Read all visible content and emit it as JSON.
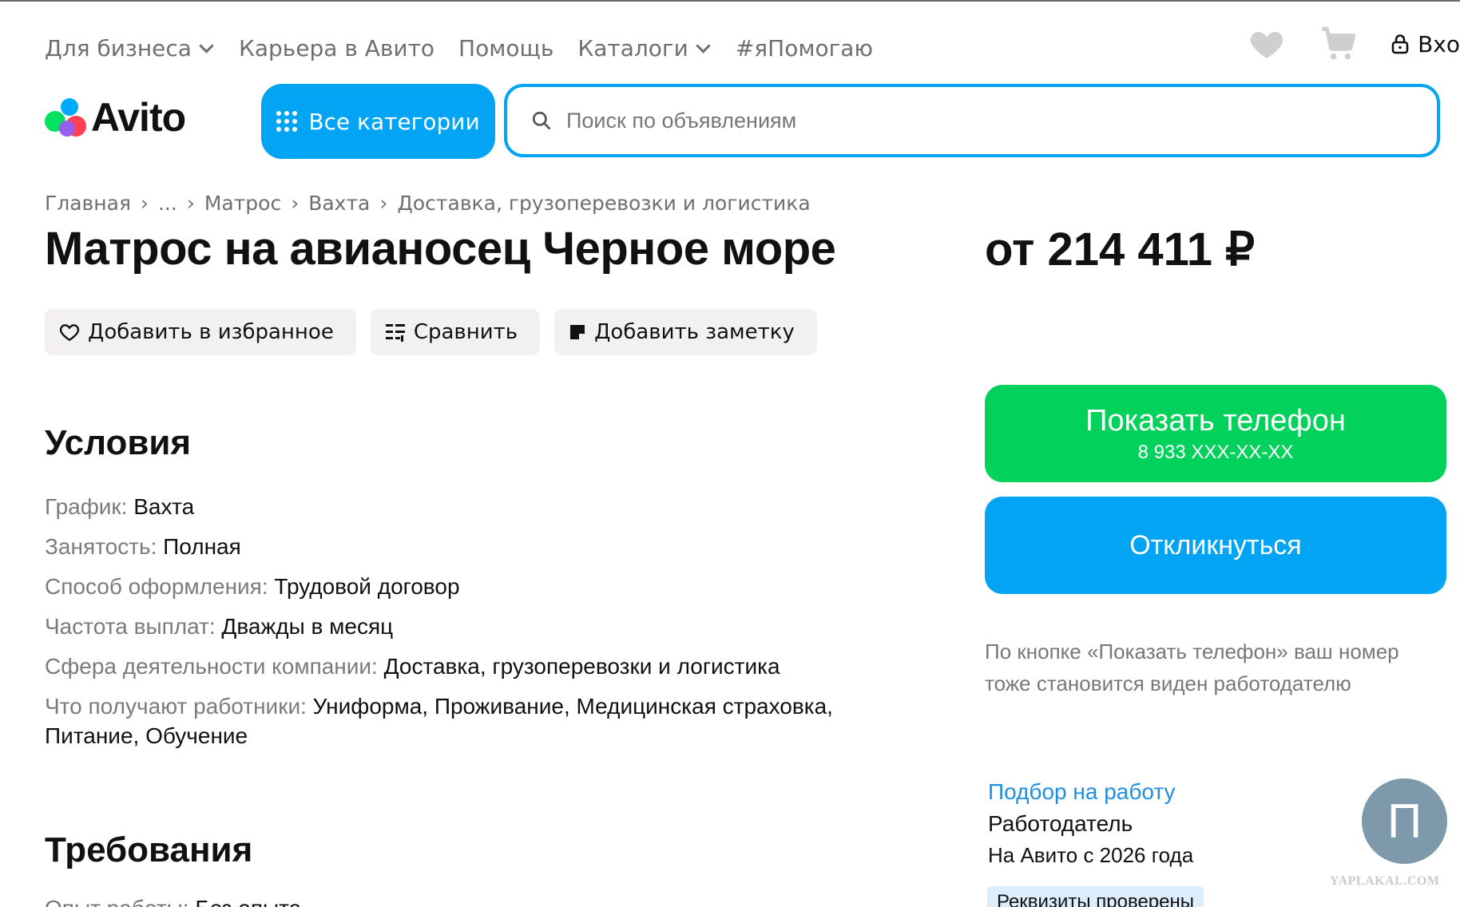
{
  "topnav": [
    {
      "label": "Для бизнеса",
      "dropdown": true
    },
    {
      "label": "Карьера в Авито",
      "dropdown": false
    },
    {
      "label": "Помощь",
      "dropdown": false
    },
    {
      "label": "Каталоги",
      "dropdown": true
    },
    {
      "label": "#яПомогаю",
      "dropdown": false
    }
  ],
  "header": {
    "login_label": "Вхо",
    "icons": [
      "favorites-heart-icon",
      "cart-icon",
      "lock-icon"
    ]
  },
  "logo": {
    "text": "Avito",
    "colors": {
      "green": "#04e061",
      "blue": "#00aaff",
      "red": "#ff4053",
      "purple": "#965eeb"
    }
  },
  "all_categories": {
    "label": "Все категории"
  },
  "search": {
    "placeholder": "Поиск по объявлениям"
  },
  "breadcrumb": [
    "Главная",
    "...",
    "Матрос",
    "Вахта",
    "Доставка, грузоперевозки и логистика"
  ],
  "listing": {
    "title": "Матрос на авианосец Черное море",
    "price": "от 214 411 ₽"
  },
  "actions": {
    "favorite": "Добавить в избранное",
    "compare": "Сравнить",
    "note": "Добавить заметку"
  },
  "conditions": {
    "heading": "Условия",
    "rows": [
      {
        "key": "График:",
        "value": "Вахта"
      },
      {
        "key": "Занятость:",
        "value": "Полная"
      },
      {
        "key": "Способ оформления:",
        "value": "Трудовой договор"
      },
      {
        "key": "Частота выплат:",
        "value": "Дважды в месяц"
      },
      {
        "key": "Сфера деятельности компании:",
        "value": "Доставка, грузоперевозки и логистика"
      },
      {
        "key": "Что получают работники:",
        "value": "Униформа, Проживание, Медицинская страховка, Питание, Обучение"
      }
    ]
  },
  "requirements": {
    "heading": "Требования",
    "partial_key": "Опыт работы:",
    "partial_value": "Без опыта"
  },
  "contact": {
    "phone_label": "Показать телефон",
    "phone_masked": "8 933 XXX-XX-XX",
    "respond_label": "Откликнуться",
    "note": "По кнопке «Показать телефон» ваш номер тоже становится виден работодателю",
    "colors": {
      "green": "#02d15c",
      "blue": "#04a4f4"
    }
  },
  "employer": {
    "link": "Подбор на работу",
    "role": "Работодатель",
    "since": "На Авито с 2026 года",
    "badge": "Реквизиты проверены",
    "avatar_letter": "П"
  },
  "watermark": "YAPLAKAL.COM"
}
